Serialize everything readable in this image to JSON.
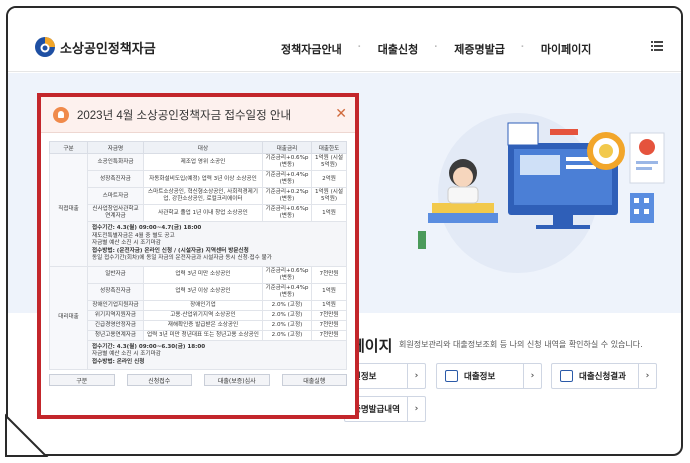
{
  "header": {
    "logo_text": "소상공인정책자금",
    "nav": [
      "정책자금안내",
      "대출신청",
      "제증명발급",
      "마이페이지"
    ]
  },
  "mypage": {
    "title": "마이페이지",
    "title_visible": "페이지",
    "description": "회원정보관리와 대출정보조회 등 나의 신청 내역을 확인하실 수 있습니다.",
    "tiles": [
      "회원정보",
      "대출정보",
      "대출신청결과",
      "제증명발급내역"
    ],
    "tiles_visible": [
      "원정보",
      "대출정보",
      "대출신청결과",
      "증명발급내역"
    ]
  },
  "popup": {
    "title": "2023년 4월 소상공인정책자금 접수일정 안내",
    "headers": [
      "구분",
      "자금명",
      "대상",
      "대출금리",
      "대출한도"
    ],
    "direct": {
      "category": "직접대출",
      "rows": [
        {
          "name": "소공인특화자금",
          "target": "제조업 영위 소공인",
          "rate": "기준금리+0.6%p (변동)",
          "limit": "1억원 (시설 5억원)"
        },
        {
          "name": "성장촉진자금",
          "target": "자동화설비도입(예정) 업력 3년 이상 소상공인",
          "rate": "기준금리+0.4%p (변동)",
          "limit": "2억원"
        },
        {
          "name": "스마트자금",
          "target": "스마트소상공인, 혁신형소상공인, 사회적경제기업, 강한소상공인, 로컬크리에이터",
          "rate": "기준금리+0.2%p (변동)",
          "limit": "1억원 (시설 5억원)"
        },
        {
          "name": "신사업창업사관학교 연계자금",
          "target": "사관학교 졸업 1년 이내 창업 소상공인",
          "rate": "기준금리+0.6%p (변동)",
          "limit": "1억원"
        }
      ],
      "notes": [
        "접수기간: 4.3(월) 09:00~4.7(금) 18:00",
        "재도전특별자금은 4월 중 별도 공고",
        "자금별 예산 소진 시 조기마감",
        "접수방법: (운전자금) 온라인 신청 / (시설자금) 지역센터 방문신청",
        "동일 접수기간(회차)에 동일 자금의 운전자금과 시설자금 동시 신청·접수 불가"
      ]
    },
    "agency": {
      "category": "대리대출",
      "rows": [
        {
          "name": "일반자금",
          "target": "업력 3년 미만 소상공인",
          "rate": "기준금리+0.6%p (변동)",
          "limit": "7천만원"
        },
        {
          "name": "성장촉진자금",
          "target": "업력 3년 이상 소상공인",
          "rate": "기준금리+0.4%p (변동)",
          "limit": "1억원"
        },
        {
          "name": "장애인기업지원자금",
          "target": "장애인기업",
          "rate": "2.0% (고정)",
          "limit": "1억원"
        },
        {
          "name": "위기지역지원자금",
          "target": "고용·산업위기지역 소상공인",
          "rate": "2.0% (고정)",
          "limit": "7천만원"
        },
        {
          "name": "긴급경영안정자금",
          "target": "재해확인증 발급받은 소상공인",
          "rate": "2.0% (고정)",
          "limit": "7천만원"
        },
        {
          "name": "청년고용연계자금",
          "target": "업력 3년 미만 청년대표 또는 청년고용 소상공인",
          "rate": "2.0% (고정)",
          "limit": "7천만원"
        }
      ],
      "notes": [
        "접수기간: 4.3(월) 09:00~6.30(금) 18:00",
        "자금별 예산 소진 시 조기마감",
        "접수방법: 온라인 신청"
      ]
    },
    "buttons": [
      "구분",
      "신청접수",
      "대출(보증)심사",
      "대출실행"
    ]
  }
}
